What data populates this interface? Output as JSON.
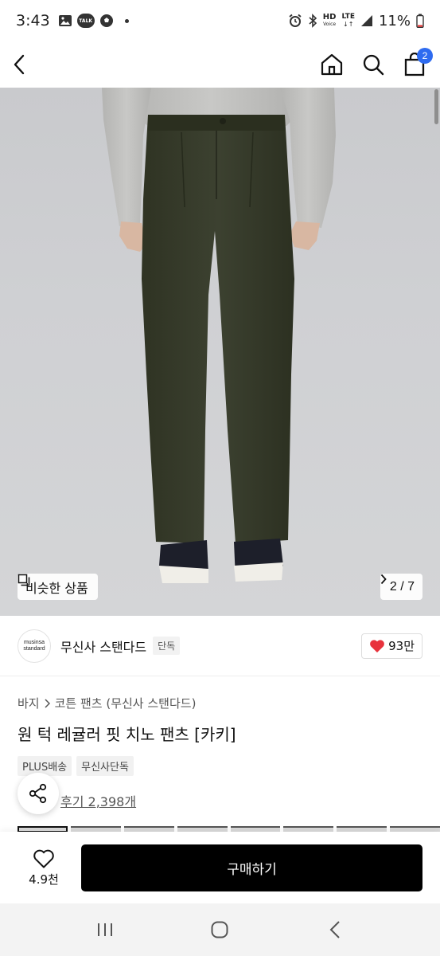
{
  "status_bar": {
    "time": "3:43",
    "talk_icon_text": "TALK",
    "hd_text": "HD",
    "voice_text": "Voice",
    "lte_text": "LTE",
    "battery": "11%"
  },
  "header": {
    "cart_count": "2"
  },
  "hero": {
    "similar_label": "비슷한 상품",
    "pager": "2 / 7"
  },
  "brand": {
    "logo_line1": "musinsa",
    "logo_line2": "standard",
    "name": "무신사 스탠다드",
    "exclusive_tag": "단독",
    "likes": "93만",
    "heart_color": "#e8323c"
  },
  "product": {
    "breadcrumb": [
      "바지",
      "코튼 팬츠 (무신사 스탠다드)"
    ],
    "title": "원 턱 레귤러 핏 치노 팬츠 [카키]",
    "chips": [
      "PLUS배송",
      "무신사단독"
    ],
    "reviews": "후기 2,398개"
  },
  "bottom_bar": {
    "like_count": "4.9천",
    "buy_label": "구매하기"
  }
}
